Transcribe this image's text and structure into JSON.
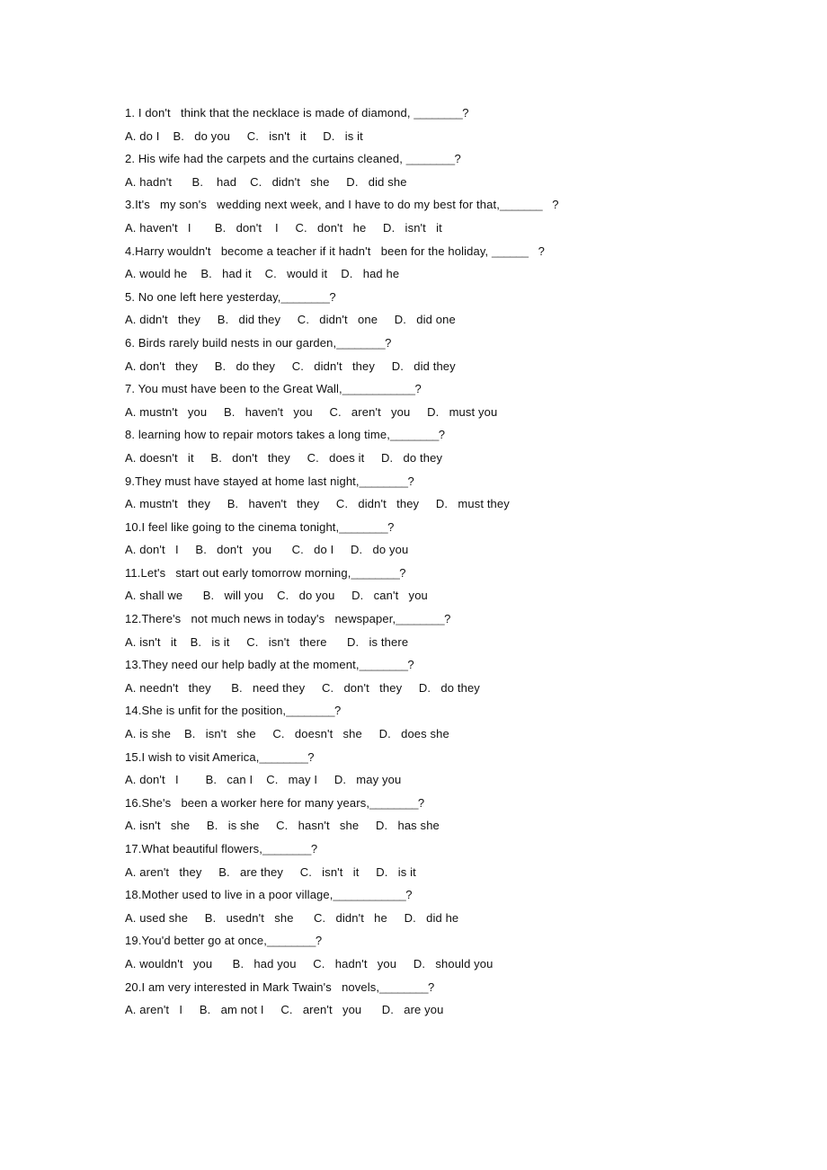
{
  "document": {
    "kind": "grammar-worksheet",
    "topic": "question-tags-multiple-choice",
    "text_color": "#101010",
    "background_color": "#ffffff",
    "question_count": 20
  },
  "questions": [
    {
      "number": "1.",
      "stem": "1. I don't   think that the necklace is made of diamond, ",
      "blank": "________",
      "tail": "?",
      "options": "A. do I    B.   do you     C.   isn't   it     D.   is it"
    },
    {
      "number": "2.",
      "stem": "2. His wife had the carpets and the curtains cleaned, ",
      "blank": "________",
      "tail": "?",
      "options": "A. hadn't      B.    had    C.   didn't   she     D.   did she"
    },
    {
      "number": "3.",
      "stem": "3.It's   my son's   wedding next week, and I have to do my best for that,",
      "blank": "_______",
      "tail": "   ?",
      "options": "A. haven't   I       B.   don't    I     C.   don't   he     D.   isn't   it"
    },
    {
      "number": "4.",
      "stem": "4.Harry wouldn't   become a teacher if it hadn't   been for the holiday, ",
      "blank": "______",
      "tail": "   ?",
      "options": "A. would he    B.   had it    C.   would it    D.   had he"
    },
    {
      "number": "5.",
      "stem": "5. No one left here yesterday,",
      "blank": "________",
      "tail": "?",
      "options": "A. didn't   they     B.   did they     C.   didn't   one     D.   did one"
    },
    {
      "number": "6.",
      "stem": "6. Birds rarely build nests in our garden,",
      "blank": "________",
      "tail": "?",
      "options": "A. don't   they     B.   do they     C.   didn't   they     D.   did they"
    },
    {
      "number": "7.",
      "stem": "7. You must have been to the Great Wall,",
      "blank": "____________",
      "tail": "?",
      "options": "A. mustn't   you     B.   haven't   you     C.   aren't   you     D.   must you"
    },
    {
      "number": "8.",
      "stem": "8. learning how to repair motors takes a long time,",
      "blank": "________",
      "tail": "?",
      "options": "A. doesn't   it     B.   don't   they     C.   does it     D.   do they"
    },
    {
      "number": "9.",
      "stem": "9.They must have stayed at home last night,",
      "blank": "________",
      "tail": "?",
      "options": "A. mustn't   they     B.   haven't   they     C.   didn't   they     D.   must they"
    },
    {
      "number": "10.",
      "stem": "10.I feel like going to the cinema tonight,",
      "blank": "________",
      "tail": "?",
      "options": "A. don't   I     B.   don't   you      C.   do I     D.   do you"
    },
    {
      "number": "11.",
      "stem": "11.Let's   start out early tomorrow morning,",
      "blank": "________",
      "tail": "?",
      "options": "A. shall we      B.   will you    C.   do you     D.   can't   you"
    },
    {
      "number": "12.",
      "stem": "12.There's   not much news in today's   newspaper,",
      "blank": "________",
      "tail": "?",
      "options": "A. isn't   it    B.   is it     C.   isn't   there      D.   is there"
    },
    {
      "number": "13.",
      "stem": "13.They need our help badly at the moment,",
      "blank": "________",
      "tail": "?",
      "options": "A. needn't   they      B.   need they     C.   don't   they     D.   do they"
    },
    {
      "number": "14.",
      "stem": "14.She is unfit for the position,",
      "blank": "________",
      "tail": "?",
      "options": "A. is she    B.   isn't   she     C.   doesn't   she     D.   does she"
    },
    {
      "number": "15.",
      "stem": "15.I wish to visit America,",
      "blank": "________",
      "tail": "?",
      "options": "A. don't   I        B.   can I    C.   may I     D.   may you"
    },
    {
      "number": "16.",
      "stem": "16.She's   been a worker here for many years,",
      "blank": "________",
      "tail": "?",
      "options": "A. isn't   she     B.   is she     C.   hasn't   she     D.   has she"
    },
    {
      "number": "17.",
      "stem": "17.What beautiful flowers,",
      "blank": "________",
      "tail": "?",
      "options": "A. aren't   they     B.   are they     C.   isn't   it     D.   is it"
    },
    {
      "number": "18.",
      "stem": "18.Mother used to live in a poor village,",
      "blank": "____________",
      "tail": "?",
      "options": "A. used she     B.   usedn't   she      C.   didn't   he     D.   did he"
    },
    {
      "number": "19.",
      "stem": "19.You'd better go at once,",
      "blank": "________",
      "tail": "?",
      "options": "A. wouldn't   you      B.   had you     C.   hadn't   you     D.   should you"
    },
    {
      "number": "20.",
      "stem": "20.I am very interested in Mark Twain's   novels,",
      "blank": "________",
      "tail": "?",
      "options": "A. aren't   I     B.   am not I     C.   aren't   you      D.   are you"
    }
  ]
}
